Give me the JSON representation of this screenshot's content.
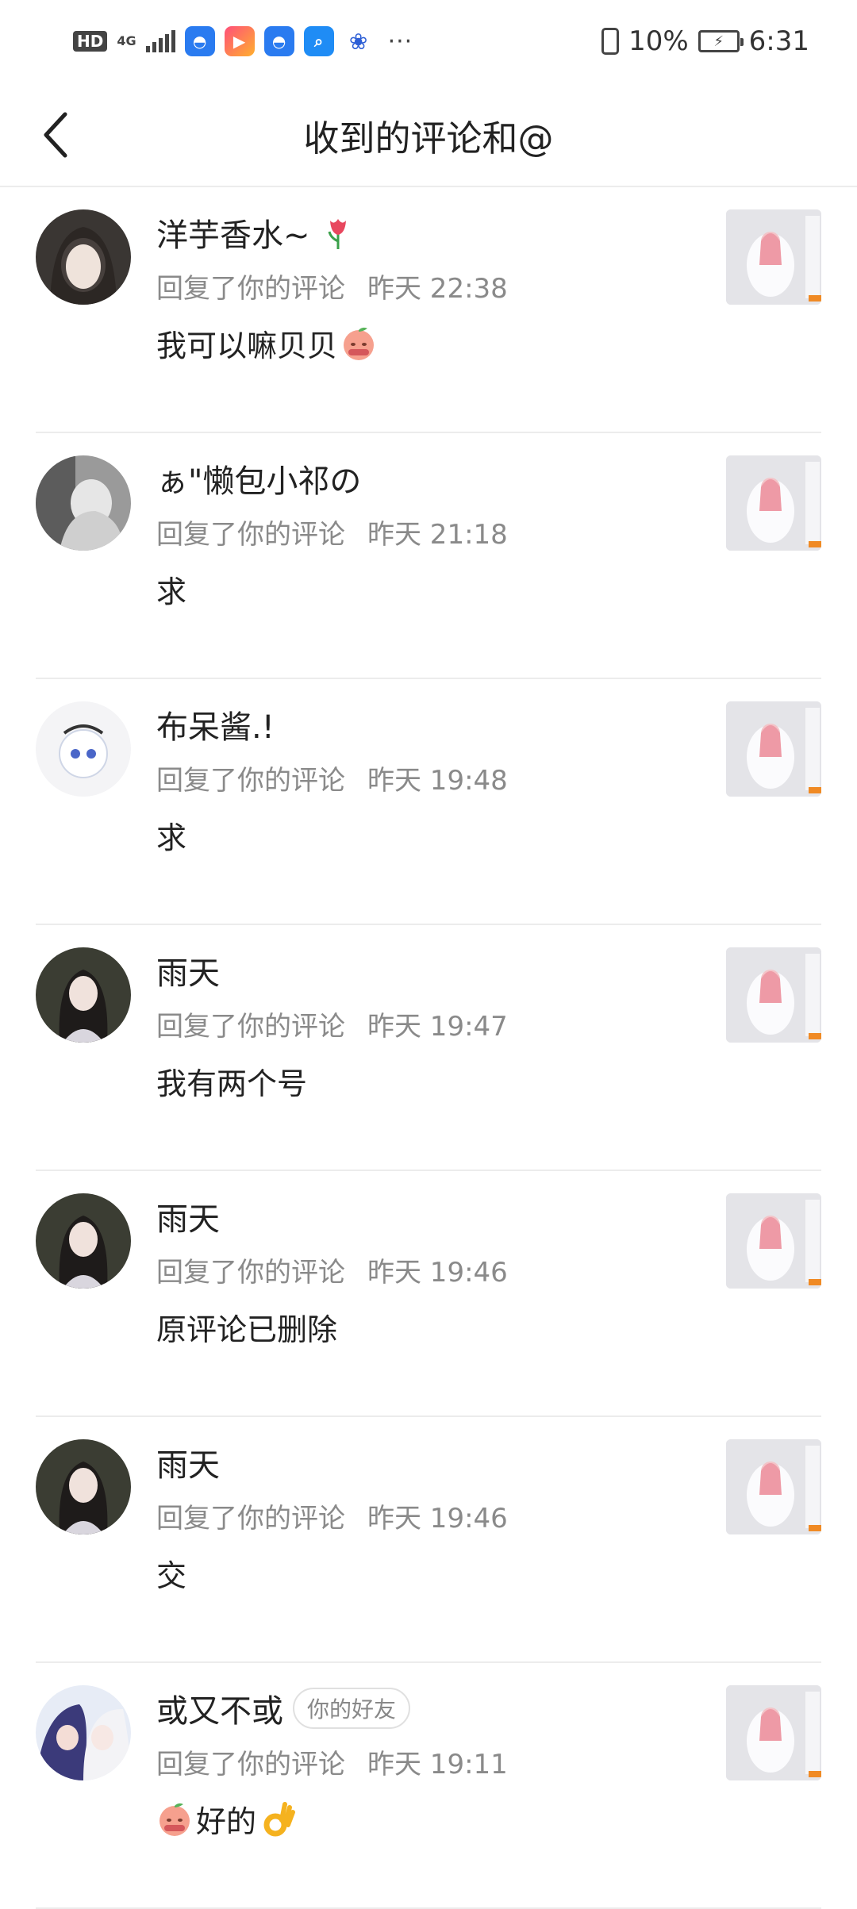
{
  "status_bar": {
    "hd": "HD",
    "network": "4G",
    "battery_percent": "10%",
    "time": "6:31",
    "icons": [
      "signal-icon",
      "app-icon",
      "video-app-icon",
      "app-icon",
      "browser-icon",
      "baidu-icon",
      "more-icon",
      "vibrate-icon",
      "battery-charging-icon"
    ]
  },
  "header": {
    "title": "收到的评论和@",
    "back_icon": "back-arrow-icon"
  },
  "comments": [
    {
      "name": "洋芋香水~",
      "name_emoji": "tulip",
      "action": "回复了你的评论",
      "time": "昨天 22:38",
      "text": "我可以嘛贝贝",
      "text_emoji_after": "peach-face",
      "friend_badge": ""
    },
    {
      "name": "ぁ\"懒包小祁の",
      "action": "回复了你的评论",
      "time": "昨天 21:18",
      "text": "求",
      "friend_badge": ""
    },
    {
      "name": "布呆酱.!",
      "action": "回复了你的评论",
      "time": "昨天 19:48",
      "text": "求",
      "friend_badge": ""
    },
    {
      "name": "雨天",
      "action": "回复了你的评论",
      "time": "昨天 19:47",
      "text": "我有两个号",
      "friend_badge": ""
    },
    {
      "name": "雨天",
      "action": "回复了你的评论",
      "time": "昨天 19:46",
      "text": "原评论已删除",
      "friend_badge": ""
    },
    {
      "name": "雨天",
      "action": "回复了你的评论",
      "time": "昨天 19:46",
      "text": "交",
      "friend_badge": ""
    },
    {
      "name": "或又不或",
      "action": "回复了你的评论",
      "time": "昨天 19:11",
      "text": "好的",
      "text_emoji_before": "peach-face",
      "text_emoji_after": "ok-hand",
      "friend_badge": "你的好友"
    }
  ],
  "colors": {
    "meta_gray": "#8a8a8a",
    "divider": "#ececec",
    "accent_orange": "#f08a24"
  }
}
